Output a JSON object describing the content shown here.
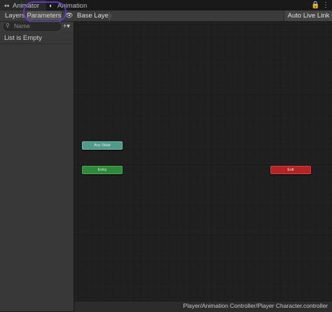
{
  "tabs": [
    {
      "label": "Animator",
      "icon": "animator-icon",
      "active": true
    },
    {
      "label": "Animation",
      "icon": "animation-icon",
      "active": false
    }
  ],
  "window_buttons": {
    "lock": "lock-icon",
    "menu": "more-options-icon"
  },
  "toolbar": {
    "layers_label": "Layers",
    "parameters_label": "Parameters",
    "breadcrumb_label": "Base Layer",
    "auto_live_link_label": "Auto Live Link"
  },
  "parameters_panel": {
    "search_placeholder": "Name",
    "empty_label": "List is Empty"
  },
  "graph": {
    "nodes": [
      {
        "label": "Any State",
        "color": "#4f9a8d"
      },
      {
        "label": "Entry",
        "color": "#2e8a3a"
      },
      {
        "label": "Exit",
        "color": "#b52424"
      }
    ]
  },
  "status": {
    "path": "Player/Animation Controller/Player Character.controller"
  },
  "colors": {
    "annotation": "#6a3bd1"
  }
}
